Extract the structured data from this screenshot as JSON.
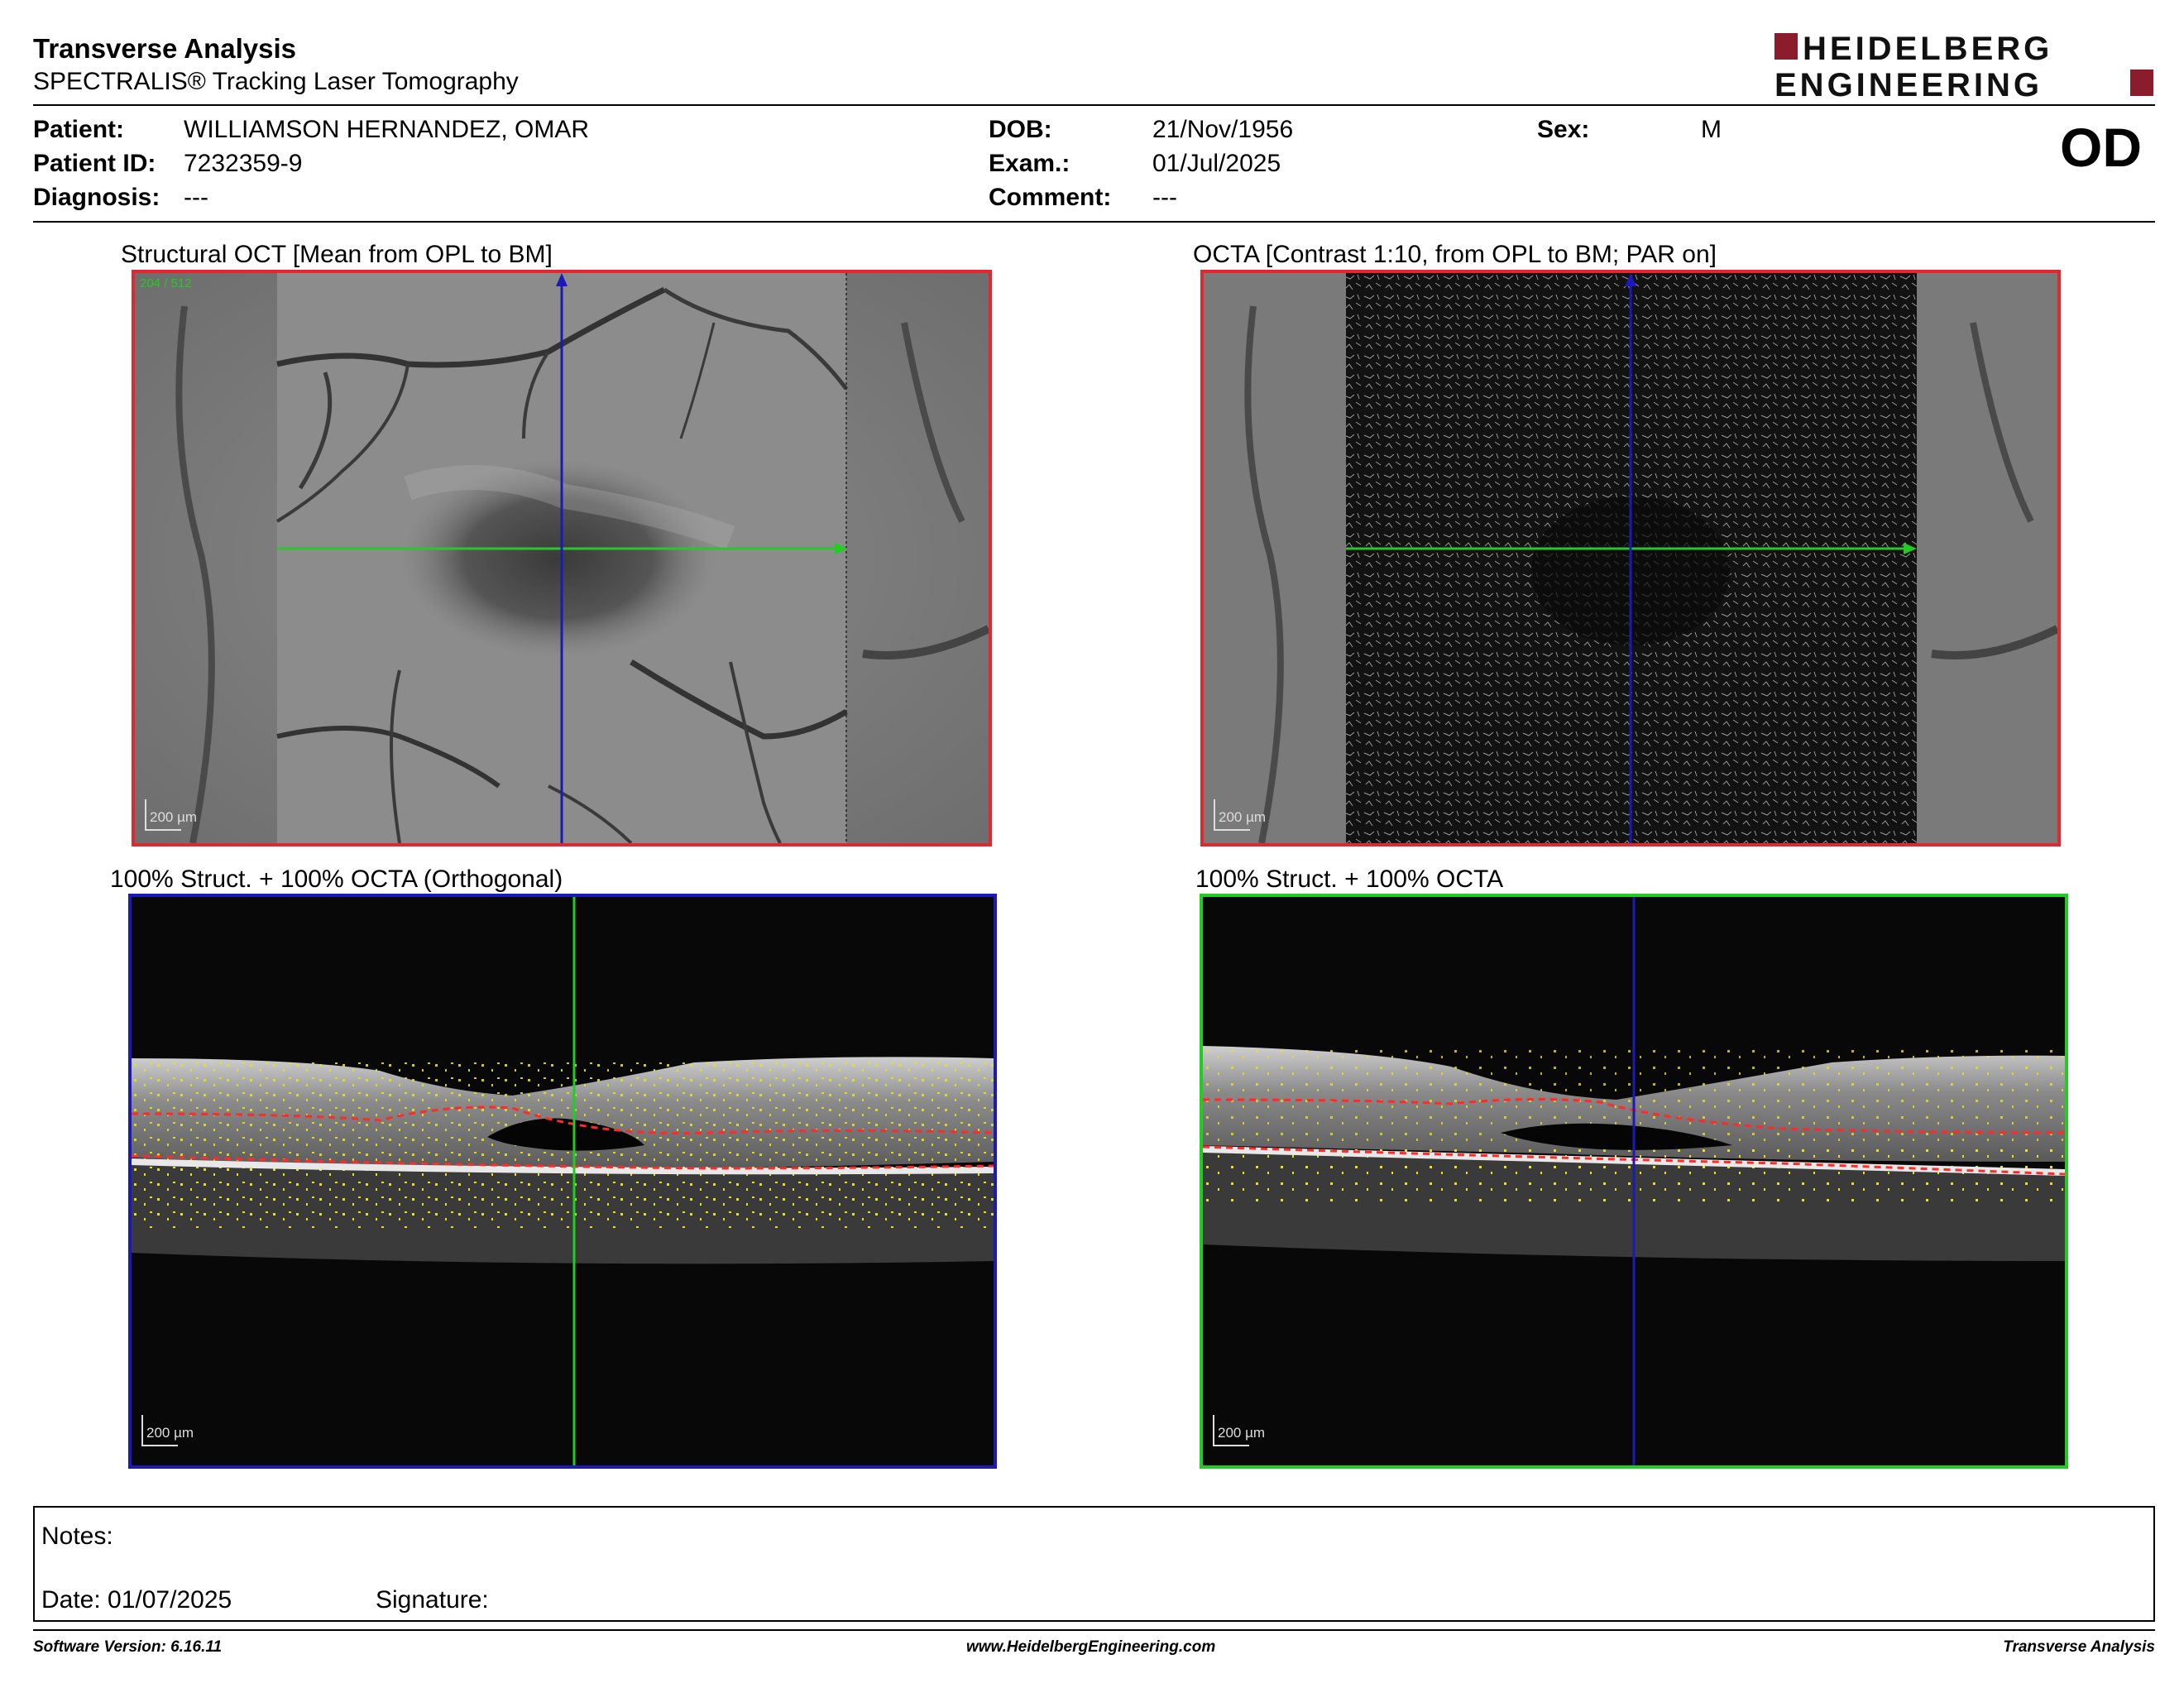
{
  "header": {
    "title": "Transverse Analysis",
    "subtitle": "SPECTRALIS® Tracking Laser Tomography",
    "logo_line1": "HEIDELBERG",
    "logo_line2": "ENGINEERING",
    "eye": "OD",
    "brand_color": "#8b1c2c"
  },
  "patient": {
    "patient_label": "Patient:",
    "patient_value": "WILLIAMSON HERNANDEZ, OMAR",
    "id_label": "Patient ID:",
    "id_value": "7232359-9",
    "diagnosis_label": "Diagnosis:",
    "diagnosis_value": "---",
    "dob_label": "DOB:",
    "dob_value": "21/Nov/1956",
    "exam_label": "Exam.:",
    "exam_value": "01/Jul/2025",
    "comment_label": "Comment:",
    "comment_value": "---",
    "sex_label": "Sex:",
    "sex_value": "M"
  },
  "panels": {
    "structural": {
      "title": "Structural OCT [Mean from OPL to BM]",
      "scale": "200 µm",
      "frame_color": "#e0282e",
      "overlay": "204 / 512"
    },
    "octa": {
      "title": "OCTA [Contrast 1:10, from OPL to BM; PAR on]",
      "scale": "200 µm",
      "frame_color": "#e0282e"
    },
    "orthogonal": {
      "title": "100% Struct. + 100% OCTA (Orthogonal)",
      "scale": "200 µm",
      "frame_color": "#1a1ab8"
    },
    "combined": {
      "title": "100% Struct. + 100% OCTA",
      "scale": "200 µm",
      "frame_color": "#22cc22"
    }
  },
  "notes": {
    "notes_label": "Notes:",
    "date_label": "Date: 01/07/2025",
    "signature_label": "Signature:"
  },
  "footer": {
    "software": "Software Version: 6.16.11",
    "website": "www.HeidelbergEngineering.com",
    "report": "Transverse Analysis"
  }
}
